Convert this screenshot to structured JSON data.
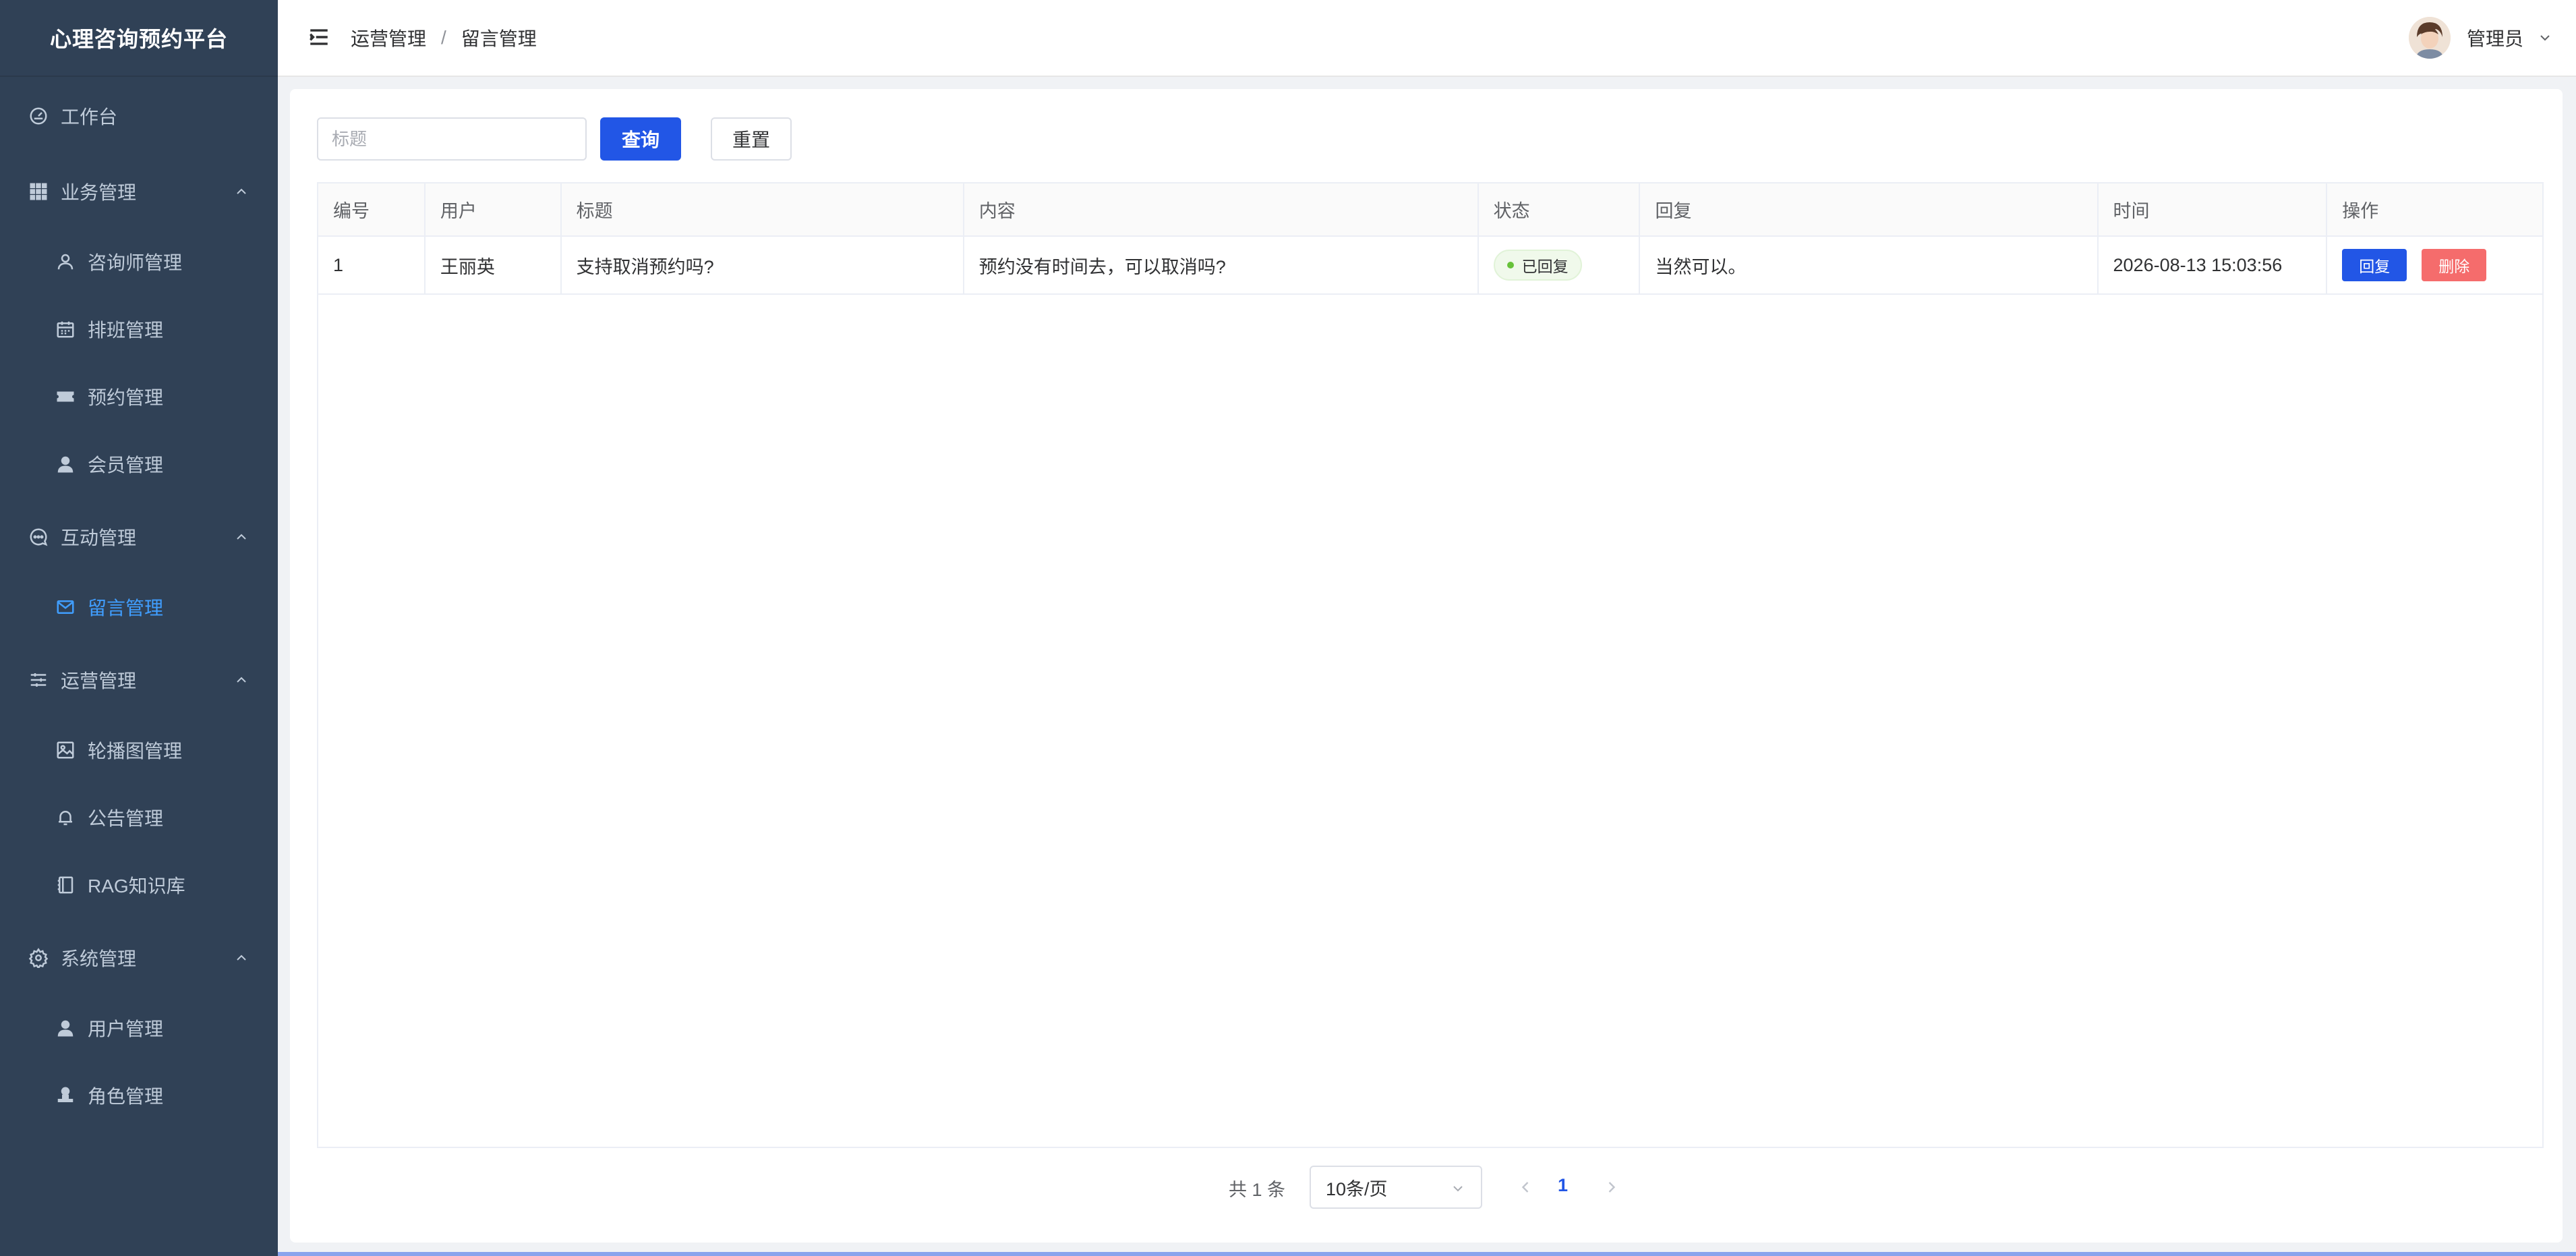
{
  "app_title": "心理咨询预约平台",
  "sidebar": {
    "items": [
      {
        "label": "工作台",
        "icon": "dashboard-icon"
      },
      {
        "label": "业务管理",
        "icon": "grid-icon"
      },
      {
        "label": "咨询师管理",
        "icon": "user-outline-icon"
      },
      {
        "label": "排班管理",
        "icon": "calendar-icon"
      },
      {
        "label": "预约管理",
        "icon": "ticket-icon"
      },
      {
        "label": "会员管理",
        "icon": "user-icon"
      },
      {
        "label": "互动管理",
        "icon": "chat-icon"
      },
      {
        "label": "留言管理",
        "icon": "message-icon"
      },
      {
        "label": "运营管理",
        "icon": "sliders-icon"
      },
      {
        "label": "轮播图管理",
        "icon": "picture-icon"
      },
      {
        "label": "公告管理",
        "icon": "bell-icon"
      },
      {
        "label": "RAG知识库",
        "icon": "notebook-icon"
      },
      {
        "label": "系统管理",
        "icon": "settings-icon"
      },
      {
        "label": "用户管理",
        "icon": "user-icon"
      },
      {
        "label": "角色管理",
        "icon": "stamp-icon"
      }
    ],
    "active_color": "#409eff",
    "background": "#304156"
  },
  "header": {
    "breadcrumb": [
      "运营管理",
      "留言管理"
    ],
    "breadcrumb_separator": "/",
    "user_name": "管理员"
  },
  "search": {
    "placeholder": "标题",
    "value": "",
    "query_label": "查询",
    "reset_label": "重置"
  },
  "table": {
    "columns": [
      "编号",
      "用户",
      "标题",
      "内容",
      "状态",
      "回复",
      "时间",
      "操作"
    ],
    "rows": [
      {
        "id": "1",
        "user": "王丽英",
        "title": "支持取消预约吗?",
        "content": "预约没有时间去，可以取消吗?",
        "status": "已回复",
        "reply": "当然可以。",
        "time": "2026-08-13 15:03:56",
        "actions": {
          "reply": "回复",
          "delete": "删除"
        }
      }
    ]
  },
  "pagination": {
    "total_text": "共 1 条",
    "page_size": "10条/页",
    "current_page": "1"
  },
  "colors": {
    "primary": "#2256e6",
    "danger": "#f56c6c",
    "success": "#67c23a"
  }
}
